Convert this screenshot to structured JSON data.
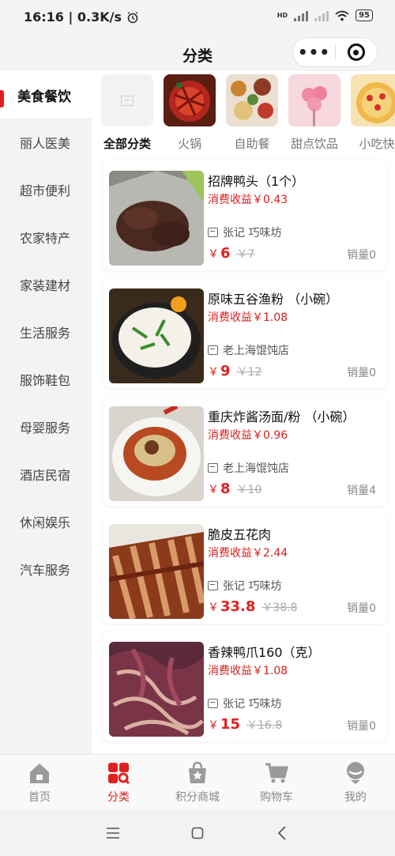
{
  "status": {
    "time_speed": "16:16 | 0.3K/s",
    "hd_label": "HD",
    "battery": "95"
  },
  "header": {
    "title": "分类",
    "more_label": "•••"
  },
  "sidebar": {
    "items": [
      {
        "label": "美食餐饮",
        "active": true
      },
      {
        "label": "丽人医美"
      },
      {
        "label": "超市便利"
      },
      {
        "label": "农家特产"
      },
      {
        "label": "家装建材"
      },
      {
        "label": "生活服务"
      },
      {
        "label": "服饰鞋包"
      },
      {
        "label": "母婴服务"
      },
      {
        "label": "酒店民宿"
      },
      {
        "label": "休闲娱乐"
      },
      {
        "label": "汽车服务"
      }
    ]
  },
  "categories": [
    {
      "label": "全部分类",
      "active": true,
      "icon": "image-placeholder-icon"
    },
    {
      "label": "火锅"
    },
    {
      "label": "自助餐"
    },
    {
      "label": "甜点饮品"
    },
    {
      "label": "小吃快"
    }
  ],
  "products": [
    {
      "title": "招牌鸭头（1个）",
      "earn": "消费收益￥0.43",
      "shop": "张记 巧味坊",
      "currency": "￥",
      "price": "6",
      "old_price": "￥7",
      "sales": "销量0"
    },
    {
      "title": "原味五谷渔粉 （小碗）",
      "earn": "消费收益￥1.08",
      "shop": "老上海馄饨店",
      "currency": "￥",
      "price": "9",
      "old_price": "￥12",
      "sales": "销量0"
    },
    {
      "title": "重庆炸酱汤面/粉 （小碗）",
      "earn": "消费收益￥0.96",
      "shop": "老上海馄饨店",
      "currency": "￥",
      "price": "8",
      "old_price": "￥10",
      "sales": "销量4"
    },
    {
      "title": "脆皮五花肉",
      "earn": "消费收益￥2.44",
      "shop": "张记 巧味坊",
      "currency": "￥",
      "price": "33.8",
      "old_price": "￥38.8",
      "sales": "销量0"
    },
    {
      "title": "香辣鸭爪160（克）",
      "earn": "消费收益￥1.08",
      "shop": "张记 巧味坊",
      "currency": "￥",
      "price": "15",
      "old_price": "￥16.8",
      "sales": "销量0"
    }
  ],
  "tabbar": {
    "items": [
      {
        "label": "首页",
        "icon": "home-icon"
      },
      {
        "label": "分类",
        "icon": "category-grid-icon",
        "active": true
      },
      {
        "label": "积分商城",
        "icon": "points-bag-icon"
      },
      {
        "label": "购物车",
        "icon": "cart-icon"
      },
      {
        "label": "我的",
        "icon": "profile-icon"
      }
    ]
  },
  "colors": {
    "accent": "#e02020",
    "sidebar_bg": "#f3f3f5",
    "muted_text": "#8a8a8a"
  }
}
